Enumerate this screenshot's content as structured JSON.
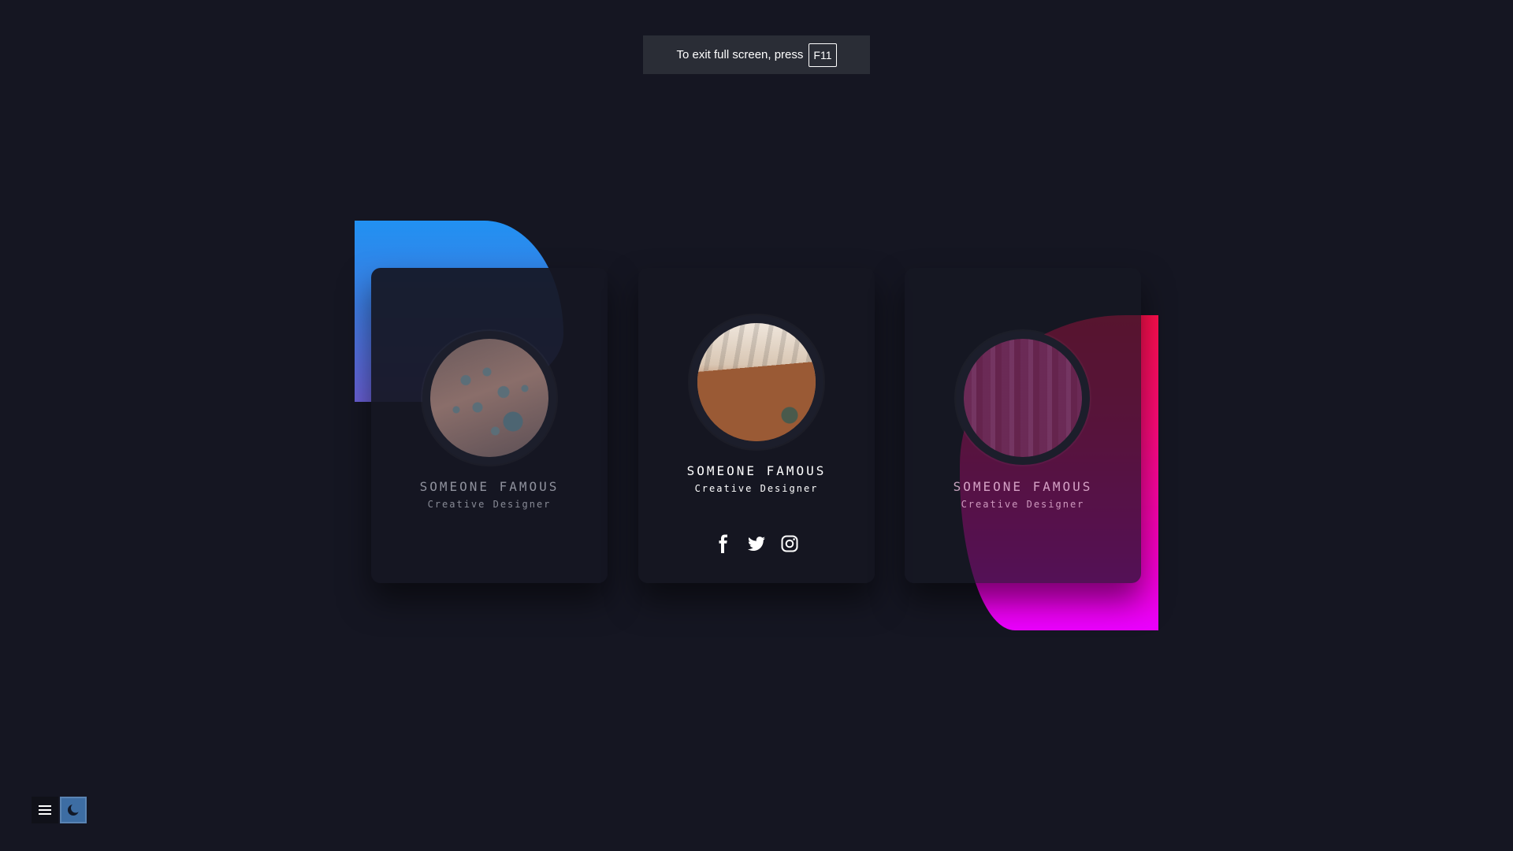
{
  "fullscreen_toast": {
    "message": "To exit full screen, press",
    "key": "F11"
  },
  "cards": [
    {
      "name": "SOMEONE FAMOUS",
      "role": "Creative Designer",
      "image": "water-drops"
    },
    {
      "name": "SOMEONE FAMOUS",
      "role": "Creative Designer",
      "image": "cafe-table"
    },
    {
      "name": "SOMEONE FAMOUS",
      "role": "Creative Designer",
      "image": "city-skyline"
    }
  ],
  "socials": [
    "facebook-icon",
    "twitter-icon",
    "instagram-icon"
  ],
  "colors": {
    "background": "#151622",
    "blob_blue": "#2191f2",
    "blob_pink": "#ff0a7a",
    "blob_magenta": "#ea00ff"
  },
  "toolbar": {
    "icons": [
      "menu-icon",
      "moon-icon"
    ]
  }
}
